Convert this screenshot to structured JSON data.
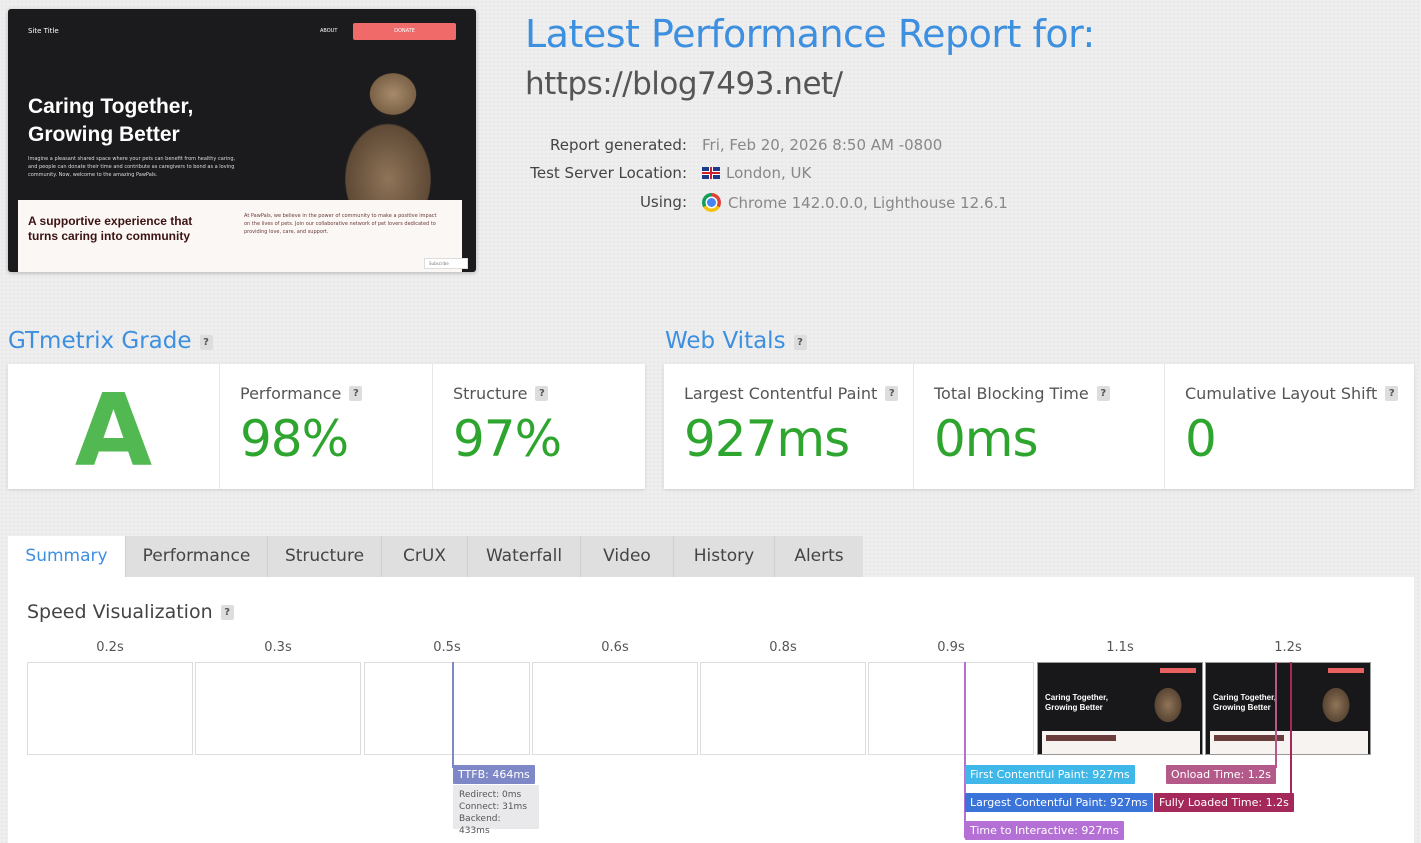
{
  "thumbnail": {
    "site_title": "Site Title",
    "nav_about": "ABOUT",
    "nav_donate": "DONATE",
    "hero_title": "Caring Together, Growing Better",
    "hero_text": "Imagine a pleasant shared space where your pets can benefit from healthy caring, and people can donate their time and contribute as caregivers to bond as a loving community. Now, welcome to the amazing PawPals.",
    "lower_title": "A supportive experience that turns caring into community",
    "lower_text": "At PawPals, we believe in the power of community to make a positive impact on the lives of pets. Join our collaborative network of pet lovers dedicated to providing love, care, and support.",
    "subscribe": "Subscribe"
  },
  "header": {
    "title": "Latest Performance Report for:",
    "url": "https://blog7493.net/"
  },
  "meta": {
    "report_generated_label": "Report generated:",
    "report_generated_value": "Fri, Feb 20, 2026 8:50 AM -0800",
    "location_label": "Test Server Location:",
    "location_value": "London, UK",
    "using_label": "Using:",
    "using_value": "Chrome 142.0.0.0, Lighthouse 12.6.1"
  },
  "grade": {
    "heading": "GTmetrix Grade",
    "help": "?",
    "letter": "A",
    "performance_label": "Performance",
    "performance_value": "98%",
    "structure_label": "Structure",
    "structure_value": "97%"
  },
  "vitals": {
    "heading": "Web Vitals",
    "help": "?",
    "lcp_label": "Largest Contentful Paint",
    "lcp_value": "927ms",
    "tbt_label": "Total Blocking Time",
    "tbt_value": "0ms",
    "cls_label": "Cumulative Layout Shift",
    "cls_value": "0"
  },
  "tabs": [
    "Summary",
    "Performance",
    "Structure",
    "CrUX",
    "Waterfall",
    "Video",
    "History",
    "Alerts"
  ],
  "speed": {
    "heading": "Speed Visualization",
    "help": "?",
    "frame_times": [
      "0.2s",
      "0.3s",
      "0.5s",
      "0.6s",
      "0.8s",
      "0.9s",
      "1.1s",
      "1.2s"
    ],
    "frame_mini_title": "Caring Together, Growing Better",
    "markers": {
      "ttfb": "TTFB: 464ms",
      "redirect": "Redirect: 0ms",
      "connect": "Connect: 31ms",
      "backend": "Backend: 433ms",
      "fcp": "First Contentful Paint: 927ms",
      "lcp": "Largest Contentful Paint: 927ms",
      "tti": "Time to Interactive: 927ms",
      "onload": "Onload Time: 1.2s",
      "fully_loaded": "Fully Loaded Time: 1.2s"
    }
  },
  "colors": {
    "accent": "#3d8fe0",
    "good": "#2ea52e",
    "ttfb": "#7f88c6",
    "fcp": "#3fb7e8",
    "lcp": "#3b74d8",
    "tti": "#b470d4",
    "onload": "#b35a8a",
    "fully_loaded": "#a5285b"
  }
}
